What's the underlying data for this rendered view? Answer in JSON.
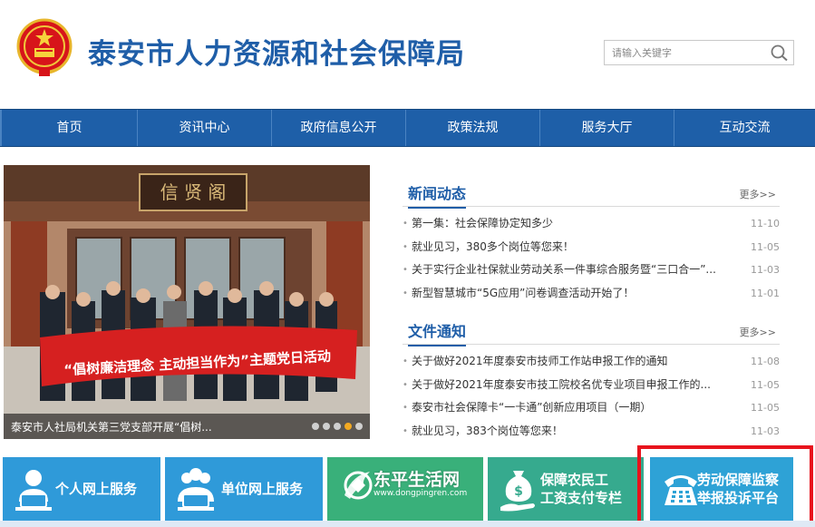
{
  "header": {
    "site_title": "泰安市人力资源和社会保障局",
    "search_placeholder": "请输入关键字"
  },
  "nav": {
    "items": [
      "首页",
      "资讯中心",
      "政府信息公开",
      "政策法规",
      "服务大厅",
      "互动交流"
    ]
  },
  "slideshow": {
    "caption": "泰安市人社局机关第三党支部开展“倡树...",
    "dot_count": 5,
    "active_dot": 4,
    "building_sign": "信 贤 阁",
    "banner_text": "泰安市人社局机关第三党支部“倡树廉洁理念 主动担当作为”主题党日活动"
  },
  "news": {
    "title": "新闻动态",
    "more": "更多>>",
    "items": [
      {
        "text": "第一集：社会保障协定知多少",
        "date": "11-10"
      },
      {
        "text": "就业见习，380多个岗位等您来！",
        "date": "11-05"
      },
      {
        "text": "关于实行企业社保就业劳动关系一件事综合服务暨“三口合一”...",
        "date": "11-03"
      },
      {
        "text": "新型智慧城市“5G应用”问卷调查活动开始了！",
        "date": "11-01"
      }
    ]
  },
  "notices": {
    "title": "文件通知",
    "more": "更多>>",
    "items": [
      {
        "text": "关于做好2021年度泰安市技师工作站申报工作的通知",
        "date": "11-08"
      },
      {
        "text": "关于做好2021年度泰安市技工院校名优专业项目申报工作的...",
        "date": "11-05"
      },
      {
        "text": "泰安市社会保障卡“一卡通”创新应用项目（一期）",
        "date": "11-05"
      },
      {
        "text": "就业见习，383个岗位等您来！",
        "date": "11-03"
      }
    ]
  },
  "services": [
    {
      "label": "个人网上服务",
      "color": "#2f9ad9",
      "icon": "person-laptop-icon"
    },
    {
      "label": "单位网上服务",
      "color": "#2f9ad9",
      "icon": "group-laptop-icon"
    },
    {
      "label": "",
      "color": "#39b07a",
      "icon": "watermark-logo-icon"
    },
    {
      "label_line1": "保障农民工",
      "label_line2": "工资支付专栏",
      "color": "#36aa8e",
      "icon": "money-bag-hand-icon"
    },
    {
      "label_line1": "劳动保障监察",
      "label_line2": "举报投诉平台",
      "color": "#2ea2d6",
      "icon": "telephone-icon"
    }
  ],
  "watermark": {
    "title": "东平生活网",
    "url": "www.dongpingren.com"
  },
  "colors": {
    "brand_blue": "#1f5ea8",
    "nav_blue": "#1e5fa8",
    "highlight_red": "#e8141d"
  }
}
